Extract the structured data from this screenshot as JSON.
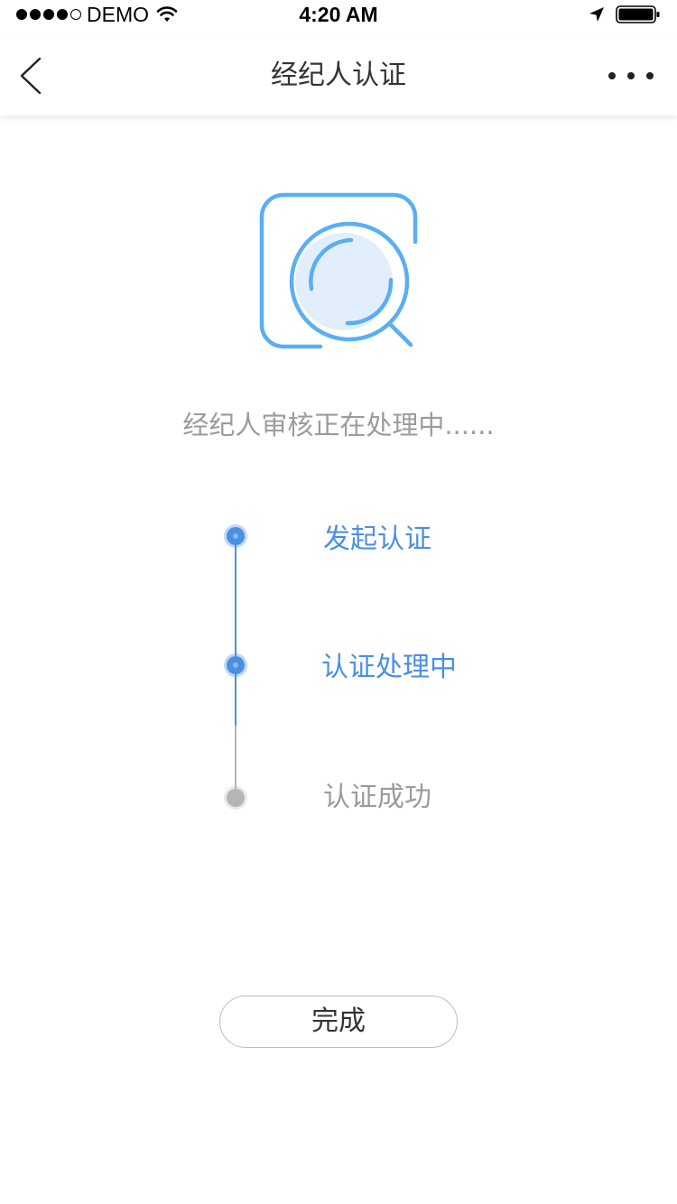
{
  "status_bar": {
    "carrier": "DEMO",
    "time": "4:20 AM",
    "signal_filled": 4,
    "signal_total": 5
  },
  "nav": {
    "title": "经纪人认证",
    "back_icon": "chevron-left-icon",
    "more_icon": "more-horizontal-icon"
  },
  "illustration": {
    "icon": "search-review-icon",
    "color": "#5aaef5",
    "fill_color": "#e3eefc"
  },
  "status_message": "经纪人审核正在处理中......",
  "steps": [
    {
      "label": "发起认证",
      "state": "done"
    },
    {
      "label": "认证处理中",
      "state": "current"
    },
    {
      "label": "认证成功",
      "state": "pending"
    }
  ],
  "done_button": {
    "label": "完成"
  },
  "colors": {
    "accent": "#4a90e2",
    "inactive": "#b5b5b5",
    "text_muted": "#9b9b9b"
  }
}
